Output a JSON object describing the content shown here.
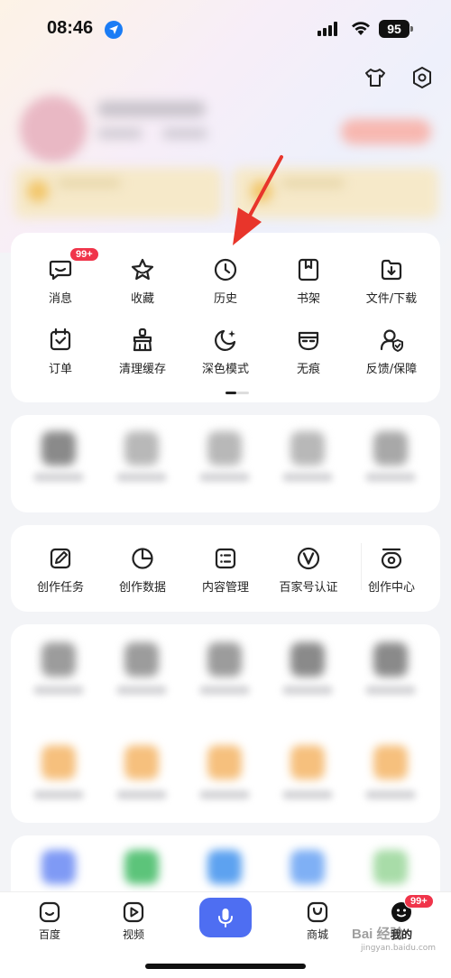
{
  "status_bar": {
    "time": "08:46",
    "battery": "95"
  },
  "tools_card": {
    "row1": [
      {
        "label": "消息",
        "icon": "message-icon",
        "badge": "99+"
      },
      {
        "label": "收藏",
        "icon": "star-icon"
      },
      {
        "label": "历史",
        "icon": "clock-icon"
      },
      {
        "label": "书架",
        "icon": "bookshelf-icon"
      },
      {
        "label": "文件/下载",
        "icon": "download-folder-icon"
      }
    ],
    "row2": [
      {
        "label": "订单",
        "icon": "order-icon"
      },
      {
        "label": "清理缓存",
        "icon": "broom-icon"
      },
      {
        "label": "深色模式",
        "icon": "moon-icon"
      },
      {
        "label": "无痕",
        "icon": "mask-icon"
      },
      {
        "label": "反馈/保障",
        "icon": "feedback-icon"
      }
    ]
  },
  "creator_card": [
    {
      "label": "创作任务",
      "icon": "task-edit-icon"
    },
    {
      "label": "创作数据",
      "icon": "pie-chart-icon"
    },
    {
      "label": "内容管理",
      "icon": "list-icon"
    },
    {
      "label": "百家号认证",
      "icon": "verified-v-icon"
    },
    {
      "label": "创作中心",
      "icon": "creator-center-icon"
    }
  ],
  "tabbar": [
    {
      "label": "百度",
      "icon": "baidu-home-icon"
    },
    {
      "label": "视频",
      "icon": "video-play-icon"
    },
    {
      "label": "",
      "icon": "microphone-icon"
    },
    {
      "label": "商城",
      "icon": "shop-bag-icon"
    },
    {
      "label": "我的",
      "icon": "profile-face-icon",
      "badge": "99+"
    }
  ],
  "watermark": {
    "main": "Bai 经验",
    "sub": "jingyan.baidu.com"
  },
  "colors": {
    "accent": "#4e6ef2",
    "badge": "#f0344a",
    "arrow": "#e8352b"
  }
}
